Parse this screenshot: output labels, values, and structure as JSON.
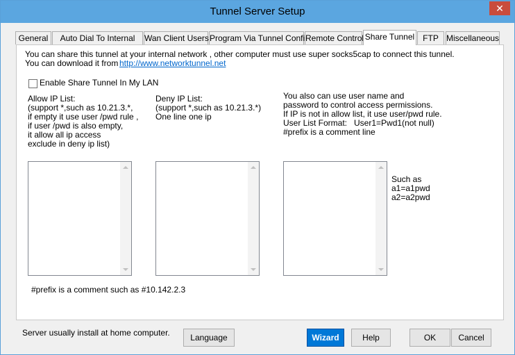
{
  "window": {
    "title": "Tunnel Server Setup",
    "close_glyph": "✕"
  },
  "tabs": [
    {
      "label": "General"
    },
    {
      "label": "Auto Dial To Internal"
    },
    {
      "label": "Wan Client Users"
    },
    {
      "label": "Program Via Tunnel Config"
    },
    {
      "label": "Remote Control"
    },
    {
      "label": "Share Tunnel",
      "active": true
    },
    {
      "label": "FTP"
    },
    {
      "label": "Miscellaneous"
    }
  ],
  "share": {
    "intro_line1": "You can share this tunnel at your internal network , other computer must use super socks5cap to connect this tunnel.",
    "intro_line2": "You can download it from",
    "download_link": "http://www.networktunnel.net",
    "enable_label": "Enable Share Tunnel In My LAN",
    "enable_checked": false,
    "allow_title": "Allow IP List:",
    "allow_desc": "(support *,such as 10.21.3.*,\nif empty it use user /pwd rule ,\nif user /pwd is also empty,\nit allow all ip access\nexclude in deny ip list)",
    "deny_title": "Deny IP List:",
    "deny_desc": "(support *,such as 10.21.3.*)\nOne line one ip",
    "user_desc": "You also can use user name and\npassword to control access permissions.\nIf IP is not in allow list, it use user/pwd rule.\nUser List Format:   User1=Pwd1(not null)\n#prefix is a comment line",
    "example": "Such as\na1=a1pwd\na2=a2pwd",
    "prefix_note": "#prefix is a comment such as #10.142.2.3"
  },
  "footer": {
    "note": "Server usually install at home computer.",
    "language": "Language",
    "wizard": "Wizard",
    "help": "Help",
    "ok": "OK",
    "cancel": "Cancel"
  }
}
